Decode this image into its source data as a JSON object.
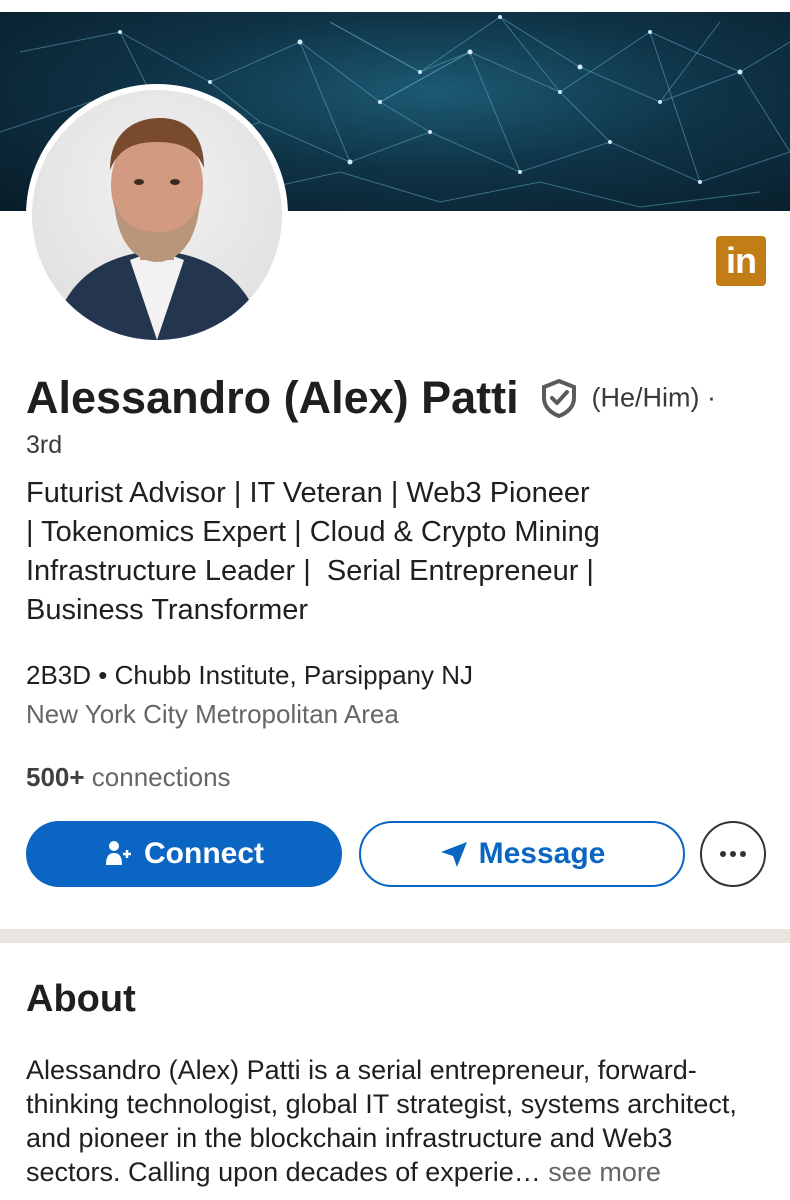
{
  "profile": {
    "name": "Alessandro (Alex) Patti",
    "pronouns": "(He/Him) ·",
    "degree": "3rd",
    "headline_lines": [
      "Futurist Advisor | IT Veteran | Web3 Pioneer",
      "| Tokenomics Expert | Cloud & Crypto Mining",
      "Infrastructure Leader |  Serial Entrepreneur |",
      "Business Transformer"
    ],
    "education": "2B3D • Chubb Institute, Parsippany NJ",
    "location": "New York City Metropolitan Area",
    "connections_count": "500+",
    "connections_label": " connections",
    "badge_text": "in"
  },
  "actions": {
    "connect_label": "Connect",
    "message_label": "Message"
  },
  "about": {
    "title": "About",
    "text": "Alessandro (Alex) Patti is a serial entrepreneur, forward-thinking technologist, global IT strategist, systems architect, and pioneer in the blockchain infrastructure and Web3 sectors. Calling upon decades of experie",
    "ellipsis": "…",
    "see_more": " see more"
  },
  "colors": {
    "primary": "#0a66c2",
    "badge": "#c37d16",
    "divider": "#e9e5df"
  },
  "icons": [
    "shield-check-icon",
    "add-person-icon",
    "send-icon",
    "more-dots-icon",
    "linkedin-icon"
  ]
}
